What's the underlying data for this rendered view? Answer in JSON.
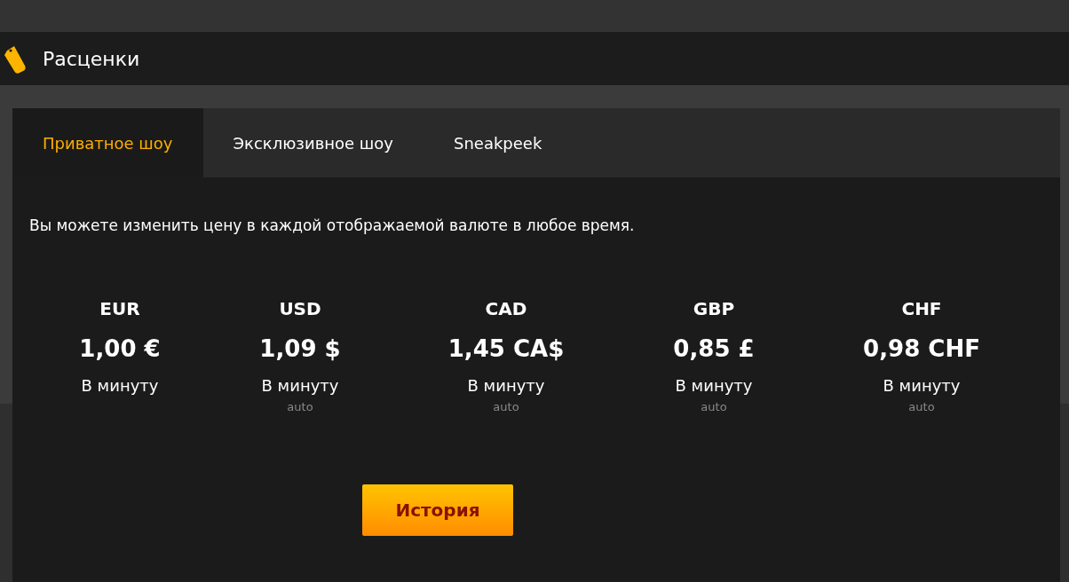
{
  "header": {
    "title": "Расценки"
  },
  "tabs": [
    {
      "label": "Приватное шоу",
      "selected": true
    },
    {
      "label": "Эксклюзивное шоу",
      "selected": false
    },
    {
      "label": "Sneakpeek",
      "selected": false
    }
  ],
  "description": "Вы можете изменить цену в каждой отображаемой валюте в любое время.",
  "rates": [
    {
      "currency": "EUR",
      "price": "1,00 €",
      "unit": "В минуту"
    },
    {
      "currency": "USD",
      "price": "1,09 $",
      "unit": "В минуту",
      "note": "auto"
    },
    {
      "currency": "CAD",
      "price": "1,45 CA$",
      "unit": "В минуту",
      "note": "auto"
    },
    {
      "currency": "GBP",
      "price": "0,85 £",
      "unit": "В минуту",
      "note": "auto"
    },
    {
      "currency": "CHF",
      "price": "0,98 CHF",
      "unit": "В минуту",
      "note": "auto"
    }
  ],
  "button": "История"
}
